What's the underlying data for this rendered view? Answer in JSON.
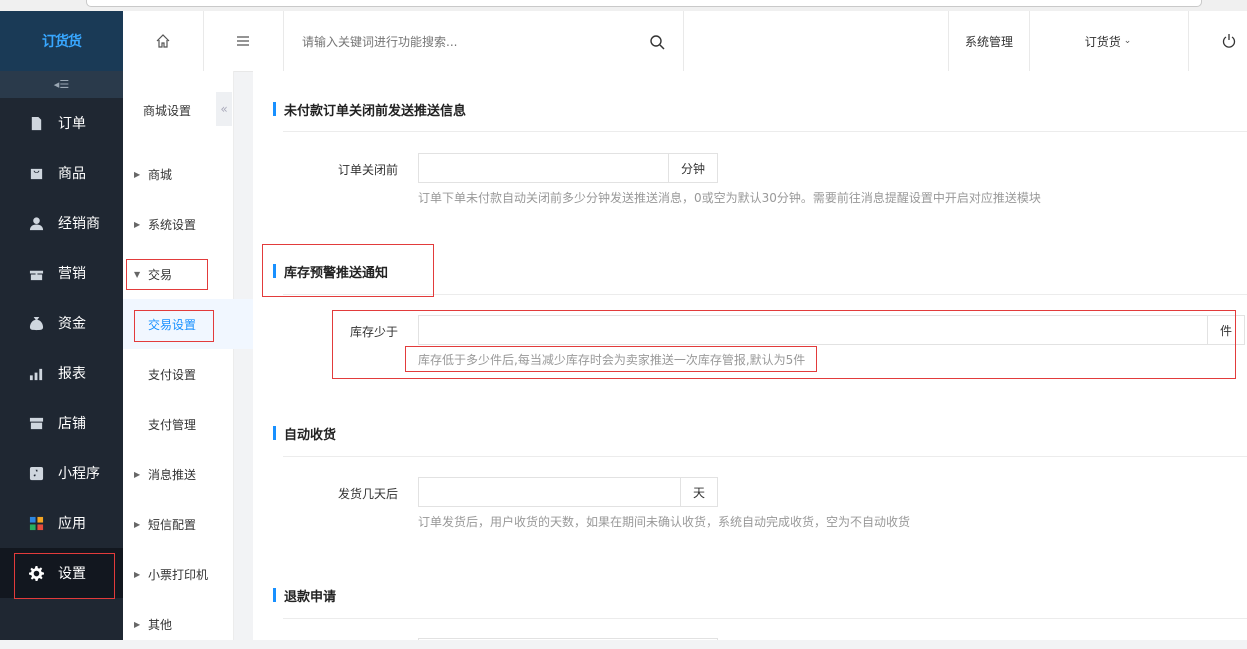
{
  "app": {
    "logo_text": "订货货"
  },
  "leftnav": {
    "collapse_icon": "collapse-icon",
    "items": [
      {
        "label": "订单",
        "icon": "document-icon"
      },
      {
        "label": "商品",
        "icon": "bag-icon"
      },
      {
        "label": "经销商",
        "icon": "user-icon"
      },
      {
        "label": "营销",
        "icon": "gift-icon"
      },
      {
        "label": "资金",
        "icon": "money-bag-icon"
      },
      {
        "label": "报表",
        "icon": "chart-icon"
      },
      {
        "label": "店铺",
        "icon": "store-icon"
      },
      {
        "label": "小程序",
        "icon": "miniprogram-icon"
      },
      {
        "label": "应用",
        "icon": "apps-icon"
      },
      {
        "label": "设置",
        "icon": "gear-icon",
        "active": true
      }
    ]
  },
  "header": {
    "search_placeholder": "请输入关键词进行功能搜索...",
    "system_manage": "系统管理",
    "store_name": "订货货",
    "icons": [
      "home-icon",
      "menu-icon",
      "search-icon",
      "chevron-down-icon",
      "power-icon"
    ]
  },
  "subnav": {
    "title": "商城设置",
    "items": [
      {
        "label": "商城",
        "type": "group"
      },
      {
        "label": "系统设置",
        "type": "group"
      },
      {
        "label": "交易",
        "type": "group",
        "expanded": true
      },
      {
        "label": "交易设置",
        "type": "child",
        "active": true
      },
      {
        "label": "支付设置",
        "type": "child"
      },
      {
        "label": "支付管理",
        "type": "child"
      },
      {
        "label": "消息推送",
        "type": "group"
      },
      {
        "label": "短信配置",
        "type": "group"
      },
      {
        "label": "小票打印机",
        "type": "group"
      },
      {
        "label": "其他",
        "type": "group"
      }
    ]
  },
  "sections": [
    {
      "title": "未付款订单关闭前发送推送信息",
      "label": "订单关闭前",
      "value": "",
      "unit": "分钟",
      "hint": "订单下单未付款自动关闭前多少分钟发送推送消息，0或空为默认30分钟。需要前往消息提醒设置中开启对应推送模块"
    },
    {
      "title": "库存预警推送通知",
      "label": "库存少于",
      "value": "",
      "unit": "件",
      "hint": "库存低于多少件后,每当减少库存时会为卖家推送一次库存管报,默认为5件"
    },
    {
      "title": "自动收货",
      "label": "发货几天后",
      "value": "",
      "unit": "天",
      "hint": "订单发货后，用户收货的天数，如果在期间未确认收货，系统自动完成收货，空为不自动收货"
    },
    {
      "title": "退款申请"
    }
  ],
  "colors": {
    "accent": "#1890ff",
    "sidebar": "#1f2732",
    "highlight_box": "#e23b3b"
  }
}
